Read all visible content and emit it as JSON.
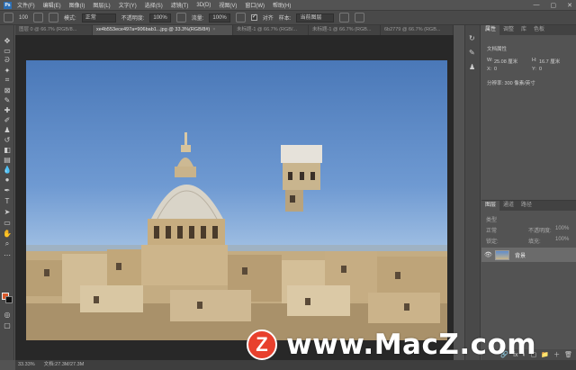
{
  "app": {
    "logo": "Ps",
    "menu": [
      "文件(F)",
      "编辑(E)",
      "图像(I)",
      "图层(L)",
      "文字(Y)",
      "选择(S)",
      "滤镜(T)",
      "3D(D)",
      "视图(V)",
      "窗口(W)",
      "帮助(H)"
    ],
    "window_controls": [
      "—",
      "▢",
      "✕"
    ]
  },
  "options_bar": {
    "brush_size": "100",
    "mode_label": "模式:",
    "mode_value": "正常",
    "opacity_label": "不透明度:",
    "opacity_value": "100%",
    "flow_label": "流量:",
    "flow_value": "100%",
    "align_label": "对齐",
    "sample_label": "样本:",
    "sample_value": "当前图层"
  },
  "tabs": [
    {
      "label": "图层 0 @ 66.7% (RGB/8...",
      "active": false
    },
    {
      "label": "xe4b553ece497a=906bab1...jpg @ 33.3%(RGB/8#)",
      "active": true
    },
    {
      "label": "未标题-1 @ 66.7% (RGB/...",
      "active": false
    },
    {
      "label": "未标题-1 @ 66.7% (RGB...",
      "active": false
    },
    {
      "label": "6b2779 @ 66.7% (RGB...",
      "active": false
    }
  ],
  "properties_panel": {
    "tabs": [
      "属性",
      "调整",
      "库",
      "色板"
    ],
    "doc_type": "文档属性",
    "width_label": "W:",
    "width_value": "25.08 厘米",
    "height_label": "H:",
    "height_value": "16.7 厘米",
    "x_label": "X:",
    "x_value": "0",
    "y_label": "Y:",
    "y_value": "0",
    "resolution": "分辨率: 300 像素/英寸"
  },
  "layers_panel": {
    "tabs": [
      "图层",
      "通道",
      "路径"
    ],
    "kind_label": "类型",
    "blend_mode": "正常",
    "opacity_label": "不透明度:",
    "opacity_value": "100%",
    "lock_label": "锁定:",
    "fill_label": "填充:",
    "fill_value": "100%",
    "layer_name": "背景",
    "footer_icons": [
      "🔗",
      "fx",
      "◐",
      "▢",
      "📁",
      "＋",
      "🗑"
    ]
  },
  "status_bar": {
    "zoom": "33.33%",
    "doc_info": "文档:27.3M/27.3M"
  },
  "watermark": {
    "logo_letter": "Z",
    "text": "www.MacZ.com"
  },
  "colors": {
    "foreground": "#d8582a",
    "background": "#111111",
    "watermark_red": "#e8402d"
  }
}
